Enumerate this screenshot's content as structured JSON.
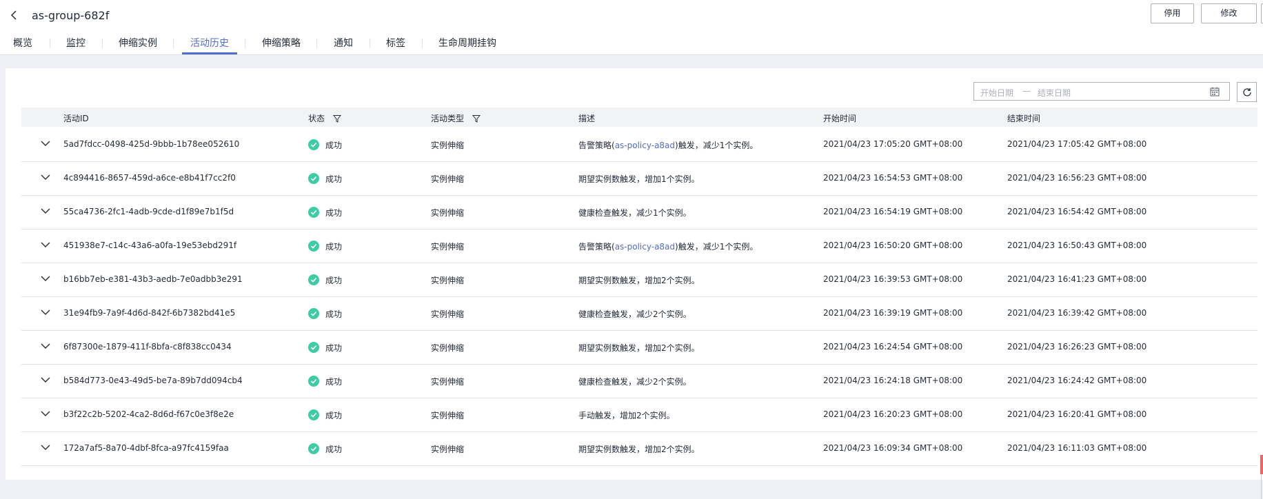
{
  "header": {
    "title": "as-group-682f",
    "buttons": {
      "stop": "停用",
      "modify": "修改"
    }
  },
  "tabs": [
    {
      "label": "概览"
    },
    {
      "label": "监控"
    },
    {
      "label": "伸缩实例"
    },
    {
      "label": "活动历史",
      "active": true
    },
    {
      "label": "伸缩策略"
    },
    {
      "label": "通知"
    },
    {
      "label": "标签"
    },
    {
      "label": "生命周期挂钩"
    }
  ],
  "filter": {
    "start_placeholder": "开始日期",
    "separator": "—",
    "end_placeholder": "结束日期"
  },
  "table": {
    "columns": {
      "id": "活动ID",
      "status": "状态",
      "type": "活动类型",
      "desc": "描述",
      "start": "开始时间",
      "end": "结束时间"
    },
    "rows": [
      {
        "id": "5ad7fdcc-0498-425d-9bbb-1b78ee052610",
        "status": "成功",
        "type": "实例伸缩",
        "desc_pre": "告警策略(",
        "desc_link": "as-policy-a8ad",
        "desc_post": ")触发，减少1个实例。",
        "start": "2021/04/23 17:05:20 GMT+08:00",
        "end": "2021/04/23 17:05:42 GMT+08:00"
      },
      {
        "id": "4c894416-8657-459d-a6ce-e8b41f7cc2f0",
        "status": "成功",
        "type": "实例伸缩",
        "desc_pre": "期望实例数触发，增加1个实例。",
        "desc_link": "",
        "desc_post": "",
        "start": "2021/04/23 16:54:53 GMT+08:00",
        "end": "2021/04/23 16:56:23 GMT+08:00"
      },
      {
        "id": "55ca4736-2fc1-4adb-9cde-d1f89e7b1f5d",
        "status": "成功",
        "type": "实例伸缩",
        "desc_pre": "健康检查触发，减少1个实例。",
        "desc_link": "",
        "desc_post": "",
        "start": "2021/04/23 16:54:19 GMT+08:00",
        "end": "2021/04/23 16:54:42 GMT+08:00"
      },
      {
        "id": "451938e7-c14c-43a6-a0fa-19e53ebd291f",
        "status": "成功",
        "type": "实例伸缩",
        "desc_pre": "告警策略(",
        "desc_link": "as-policy-a8ad",
        "desc_post": ")触发，减少1个实例。",
        "start": "2021/04/23 16:50:20 GMT+08:00",
        "end": "2021/04/23 16:50:43 GMT+08:00"
      },
      {
        "id": "b16bb7eb-e381-43b3-aedb-7e0adbb3e291",
        "status": "成功",
        "type": "实例伸缩",
        "desc_pre": "期望实例数触发，增加2个实例。",
        "desc_link": "",
        "desc_post": "",
        "start": "2021/04/23 16:39:53 GMT+08:00",
        "end": "2021/04/23 16:41:23 GMT+08:00"
      },
      {
        "id": "31e94fb9-7a9f-4d6d-842f-6b7382bd41e5",
        "status": "成功",
        "type": "实例伸缩",
        "desc_pre": "健康检查触发，减少2个实例。",
        "desc_link": "",
        "desc_post": "",
        "start": "2021/04/23 16:39:19 GMT+08:00",
        "end": "2021/04/23 16:39:42 GMT+08:00"
      },
      {
        "id": "6f87300e-1879-411f-8bfa-c8f838cc0434",
        "status": "成功",
        "type": "实例伸缩",
        "desc_pre": "期望实例数触发，增加2个实例。",
        "desc_link": "",
        "desc_post": "",
        "start": "2021/04/23 16:24:54 GMT+08:00",
        "end": "2021/04/23 16:26:23 GMT+08:00"
      },
      {
        "id": "b584d773-0e43-49d5-be7a-89b7dd094cb4",
        "status": "成功",
        "type": "实例伸缩",
        "desc_pre": "健康检查触发，减少2个实例。",
        "desc_link": "",
        "desc_post": "",
        "start": "2021/04/23 16:24:18 GMT+08:00",
        "end": "2021/04/23 16:24:42 GMT+08:00"
      },
      {
        "id": "b3f22c2b-5202-4ca2-8d6d-f67c0e3f8e2e",
        "status": "成功",
        "type": "实例伸缩",
        "desc_pre": "手动触发，增加2个实例。",
        "desc_link": "",
        "desc_post": "",
        "start": "2021/04/23 16:20:23 GMT+08:00",
        "end": "2021/04/23 16:20:41 GMT+08:00"
      },
      {
        "id": "172a7af5-8a70-4dbf-8fca-a97fc4159faa",
        "status": "成功",
        "type": "实例伸缩",
        "desc_pre": "期望实例数触发，增加2个实例。",
        "desc_link": "",
        "desc_post": "",
        "start": "2021/04/23 16:09:34 GMT+08:00",
        "end": "2021/04/23 16:11:03 GMT+08:00"
      }
    ]
  },
  "colors": {
    "accent": "#526ecc",
    "success": "#3dcca6",
    "border": "#dfe1e6"
  }
}
